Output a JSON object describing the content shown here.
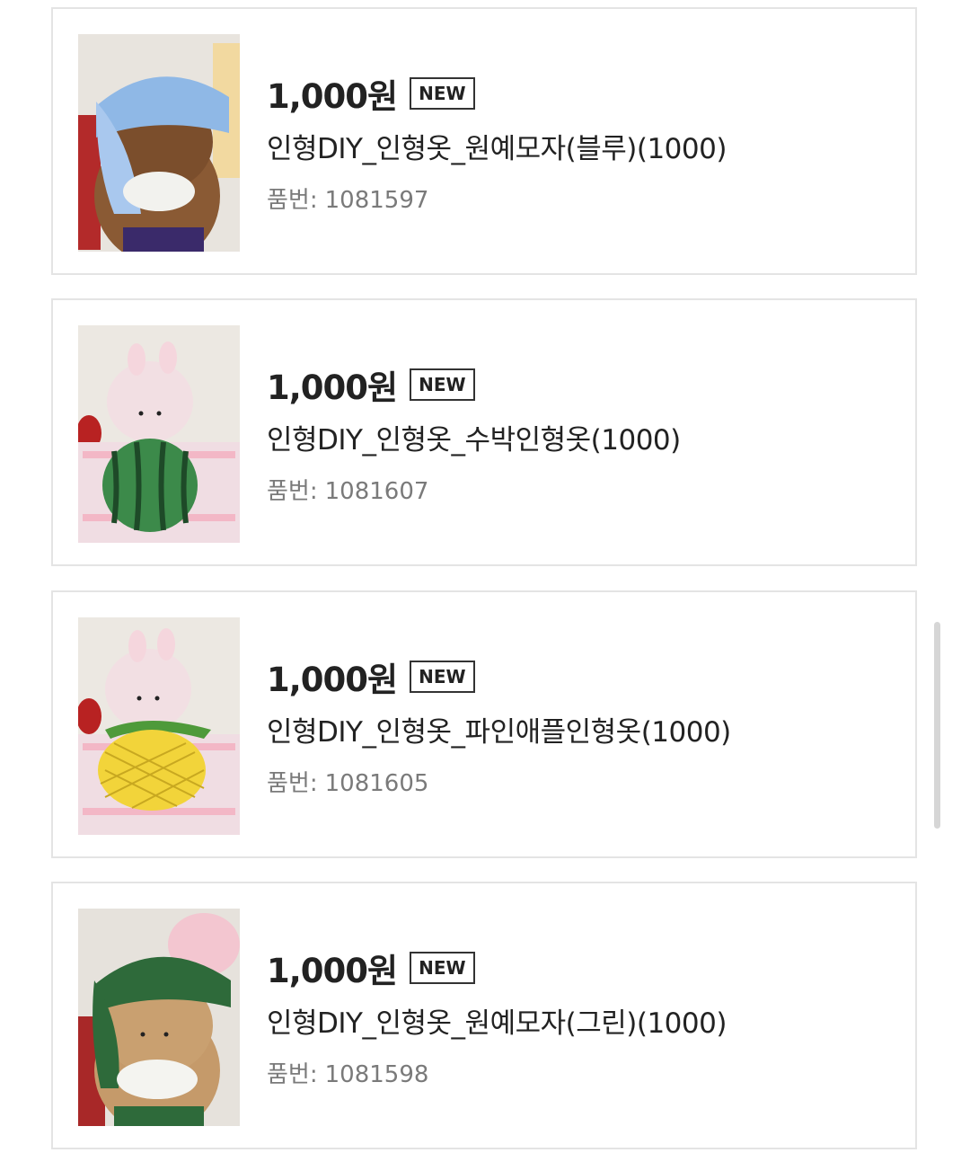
{
  "products": [
    {
      "price": "1,000원",
      "badge": "NEW",
      "name": "인형DIY_인형옷_원예모자(블루)(1000)",
      "code_label": "품번:",
      "code_value": "1081597"
    },
    {
      "price": "1,000원",
      "badge": "NEW",
      "name": "인형DIY_인형옷_수박인형옷(1000)",
      "code_label": "품번:",
      "code_value": "1081607"
    },
    {
      "price": "1,000원",
      "badge": "NEW",
      "name": "인형DIY_인형옷_파인애플인형옷(1000)",
      "code_label": "품번:",
      "code_value": "1081605"
    },
    {
      "price": "1,000원",
      "badge": "NEW",
      "name": "인형DIY_인형옷_원예모자(그린)(1000)",
      "code_label": "품번:",
      "code_value": "1081598"
    }
  ],
  "colors": {
    "border": "#e4e4e4",
    "text": "#222222",
    "muted": "#7a7a7a"
  }
}
